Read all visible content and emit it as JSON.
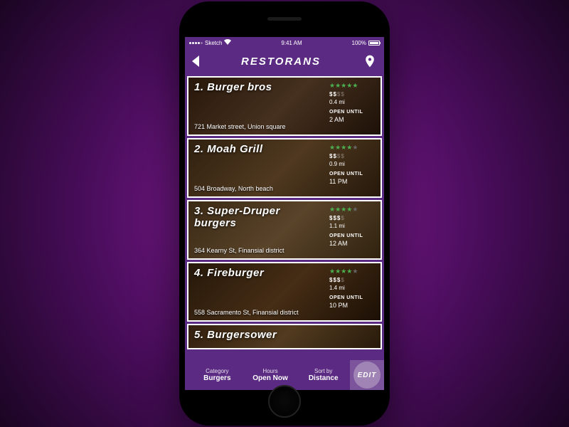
{
  "statusbar": {
    "carrier": "Sketch",
    "time": "9:41 AM",
    "battery": "100%"
  },
  "header": {
    "title": "RESTORANS"
  },
  "restaurants": [
    {
      "name": "1. Burger bros",
      "address": "721 Market street, Union square",
      "stars": 5,
      "price": "$$",
      "dist": "0.4 mi",
      "hours_label": "OPEN UNTIL",
      "hours": "2 AM"
    },
    {
      "name": "2. Moah Grill",
      "address": "504 Broadway, North beach",
      "stars": 4,
      "price": "$$",
      "dist": "0.9 mi",
      "hours_label": "OPEN UNTIL",
      "hours": "11 PM"
    },
    {
      "name": "3. Super-Druper burgers",
      "address": "364 Kearny St, Finansial district",
      "stars": 4,
      "price": "$$$",
      "dist": "1.1 mi",
      "hours_label": "OPEN UNTIL",
      "hours": "12 AM"
    },
    {
      "name": "4. Fireburger",
      "address": "558 Sacramento St, Finansial district",
      "stars": 4,
      "price": "$$$",
      "dist": "1.4 mi",
      "hours_label": "OPEN UNTIL",
      "hours": "10 PM"
    },
    {
      "name": "5. Burgersower",
      "address": "",
      "stars": 0,
      "price": "",
      "dist": "",
      "hours_label": "",
      "hours": ""
    }
  ],
  "footer": {
    "category": {
      "label": "Category",
      "value": "Burgers"
    },
    "hours": {
      "label": "Hours",
      "value": "Open Now"
    },
    "sort": {
      "label": "Sort by",
      "value": "Distance"
    },
    "edit": "EDIT"
  }
}
